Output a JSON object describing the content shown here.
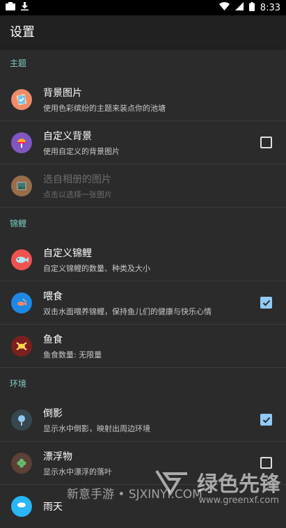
{
  "status_bar": {
    "time": "8:33"
  },
  "app_bar": {
    "title": "设置"
  },
  "sections": [
    {
      "header": "主题"
    },
    {
      "header": "锦鲤"
    },
    {
      "header": "环境"
    }
  ],
  "items": {
    "background_image": {
      "title": "背景图片",
      "summary": "使用色彩缤纷的主题来装点你的池塘"
    },
    "custom_background": {
      "title": "自定义背景",
      "summary": "使用自定义的背景图片",
      "checked": false
    },
    "choose_from_album": {
      "title": "选自相册的图片",
      "summary": "点击以选择一张图片",
      "enabled": false
    },
    "custom_koi": {
      "title": "自定义锦鲤",
      "summary": "自定义锦鲤的数量、种类及大小"
    },
    "feed": {
      "title": "喂食",
      "summary": "双击水面喂养锦鲤，保持鱼儿们的健康与快乐心情",
      "checked": true
    },
    "fish_food": {
      "title": "鱼食",
      "summary": "鱼食数量: 无限量"
    },
    "reflection": {
      "title": "倒影",
      "summary": "显示水中倒影，映射出周边环境",
      "checked": true
    },
    "floating": {
      "title": "漂浮物",
      "summary": "显示水中漂浮的落叶",
      "checked": false
    },
    "rain": {
      "title": "雨天"
    }
  },
  "watermark": {
    "left_text": "新意手游 • SJXINYI.COM",
    "brand": "绿色先锋",
    "url": "www.greenxf.com"
  },
  "colors": {
    "accent": "#80cbc4",
    "checkbox_checked": "#90caf9",
    "background": "#2b2b2b"
  }
}
